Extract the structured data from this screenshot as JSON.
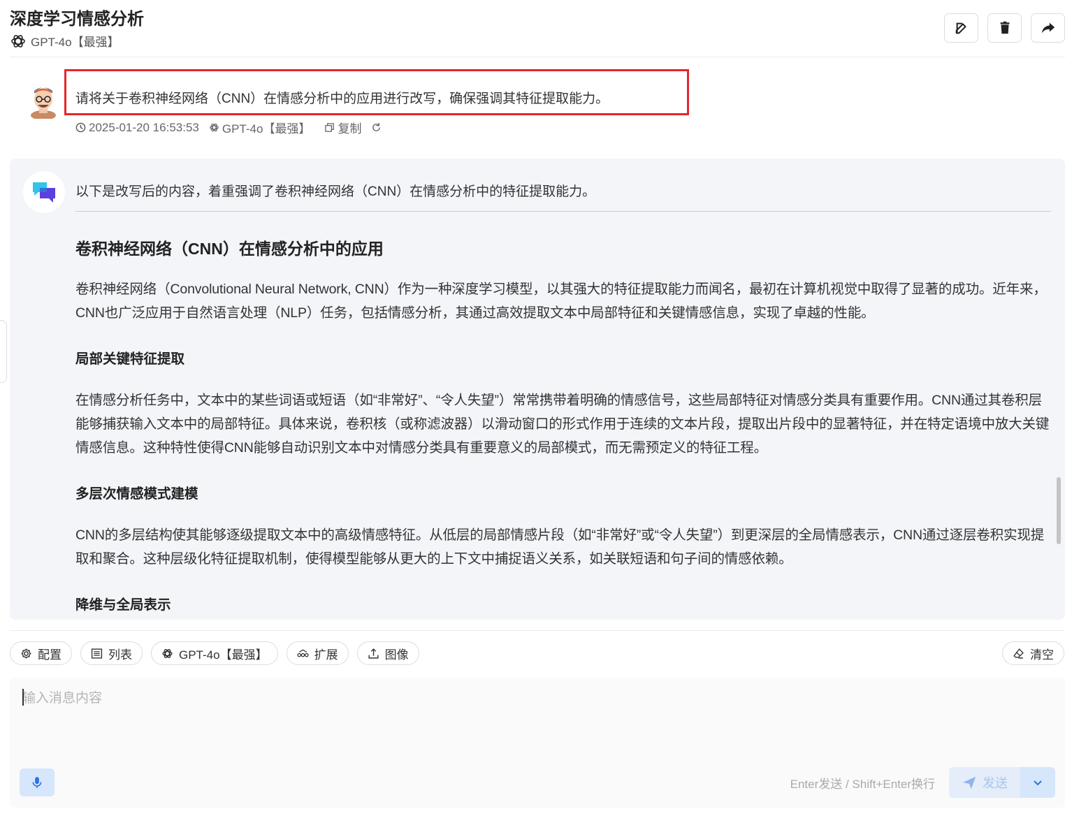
{
  "header": {
    "title": "深度学习情感分析",
    "model_label": "GPT-4o【最强】",
    "actions": [
      "edit-icon",
      "trash-icon",
      "share-icon"
    ]
  },
  "user_message": {
    "text": "请将关于卷积神经网络（CNN）在情感分析中的应用进行改写，确保强调其特征提取能力。",
    "timestamp": "2025-01-20 16:53:53",
    "model": "GPT-4o【最强】",
    "copy_label": "复制"
  },
  "assistant_message": {
    "intro": "以下是改写后的内容，着重强调了卷积神经网络（CNN）在情感分析中的特征提取能力。",
    "heading": "卷积神经网络（CNN）在情感分析中的应用",
    "paragraph1": "卷积神经网络（Convolutional Neural Network, CNN）作为一种深度学习模型，以其强大的特征提取能力而闻名，最初在计算机视觉中取得了显著的成功。近年来，CNN也广泛应用于自然语言处理（NLP）任务，包括情感分析，其通过高效提取文本中局部特征和关键情感信息，实现了卓越的性能。",
    "section1_title": "局部关键特征提取",
    "section1_text": "在情感分析任务中，文本中的某些词语或短语（如“非常好”、“令人失望”）常常携带着明确的情感信号，这些局部特征对情感分类具有重要作用。CNN通过其卷积层能够捕获输入文本中的局部特征。具体来说，卷积核（或称滤波器）以滑动窗口的形式作用于连续的文本片段，提取出片段中的显著特征，并在特定语境中放大关键情感信息。这种特性使得CNN能够自动识别文本中对情感分类具有重要意义的局部模式，而无需预定义的特征工程。",
    "section2_title": "多层次情感模式建模",
    "section2_text": "CNN的多层结构使其能够逐级提取文本中的高级情感特征。从低层的局部情感片段（如“非常好”或“令人失望”）到更深层的全局情感表示，CNN通过逐层卷积实现提取和聚合。这种层级化特征提取机制，使得模型能够从更大的上下文中捕捉语义关系，如关联短语和句子间的情感依赖。",
    "section3_title": "降维与全局表示"
  },
  "toolbar": {
    "config": "配置",
    "list": "列表",
    "model": "GPT-4o【最强】",
    "extend": "扩展",
    "image": "图像",
    "clear": "清空"
  },
  "input": {
    "placeholder": "输入消息内容",
    "hint": "Enter发送 / Shift+Enter换行",
    "send": "发送"
  },
  "colors": {
    "highlight_border": "#e5262b",
    "assistant_bg": "#f3f5f9",
    "send_bg": "#e4edf9"
  }
}
